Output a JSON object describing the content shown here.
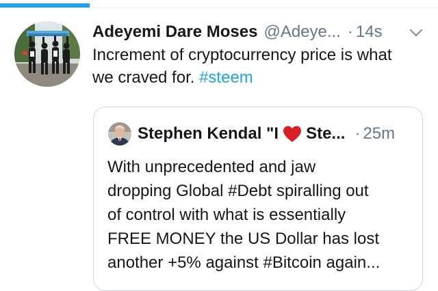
{
  "progress": {
    "fraction": 0.205
  },
  "tweet": {
    "author_name": "Adeyemi Dare Moses",
    "author_handle": "@Adeye...",
    "separator": "·",
    "time": "14s",
    "text_main": "Increment of cryptocurrency price is what we craved for. ",
    "hashtag": "#steem",
    "menu_icon": "chevron-down-icon",
    "avatar_icon": "group-photo-avatar"
  },
  "quoted_tweet": {
    "author_name_start": "Stephen Kendal \"I",
    "heart_icon": "red-heart-icon",
    "author_name_end": "Ste...",
    "separator": "·",
    "time": "25m",
    "avatar_icon": "man-in-suit-avatar",
    "lines": [
      "With unprecedented and jaw",
      "dropping Global #Debt spiralling out",
      "of control with what is essentially",
      "FREE MONEY the US Dollar has lost",
      "another +5% against #Bitcoin again..."
    ]
  },
  "colors": {
    "accent": "#1da1f2",
    "text": "#14171a",
    "muted": "#657786",
    "border": "#ccd6dd",
    "heart": "#e0245e"
  }
}
